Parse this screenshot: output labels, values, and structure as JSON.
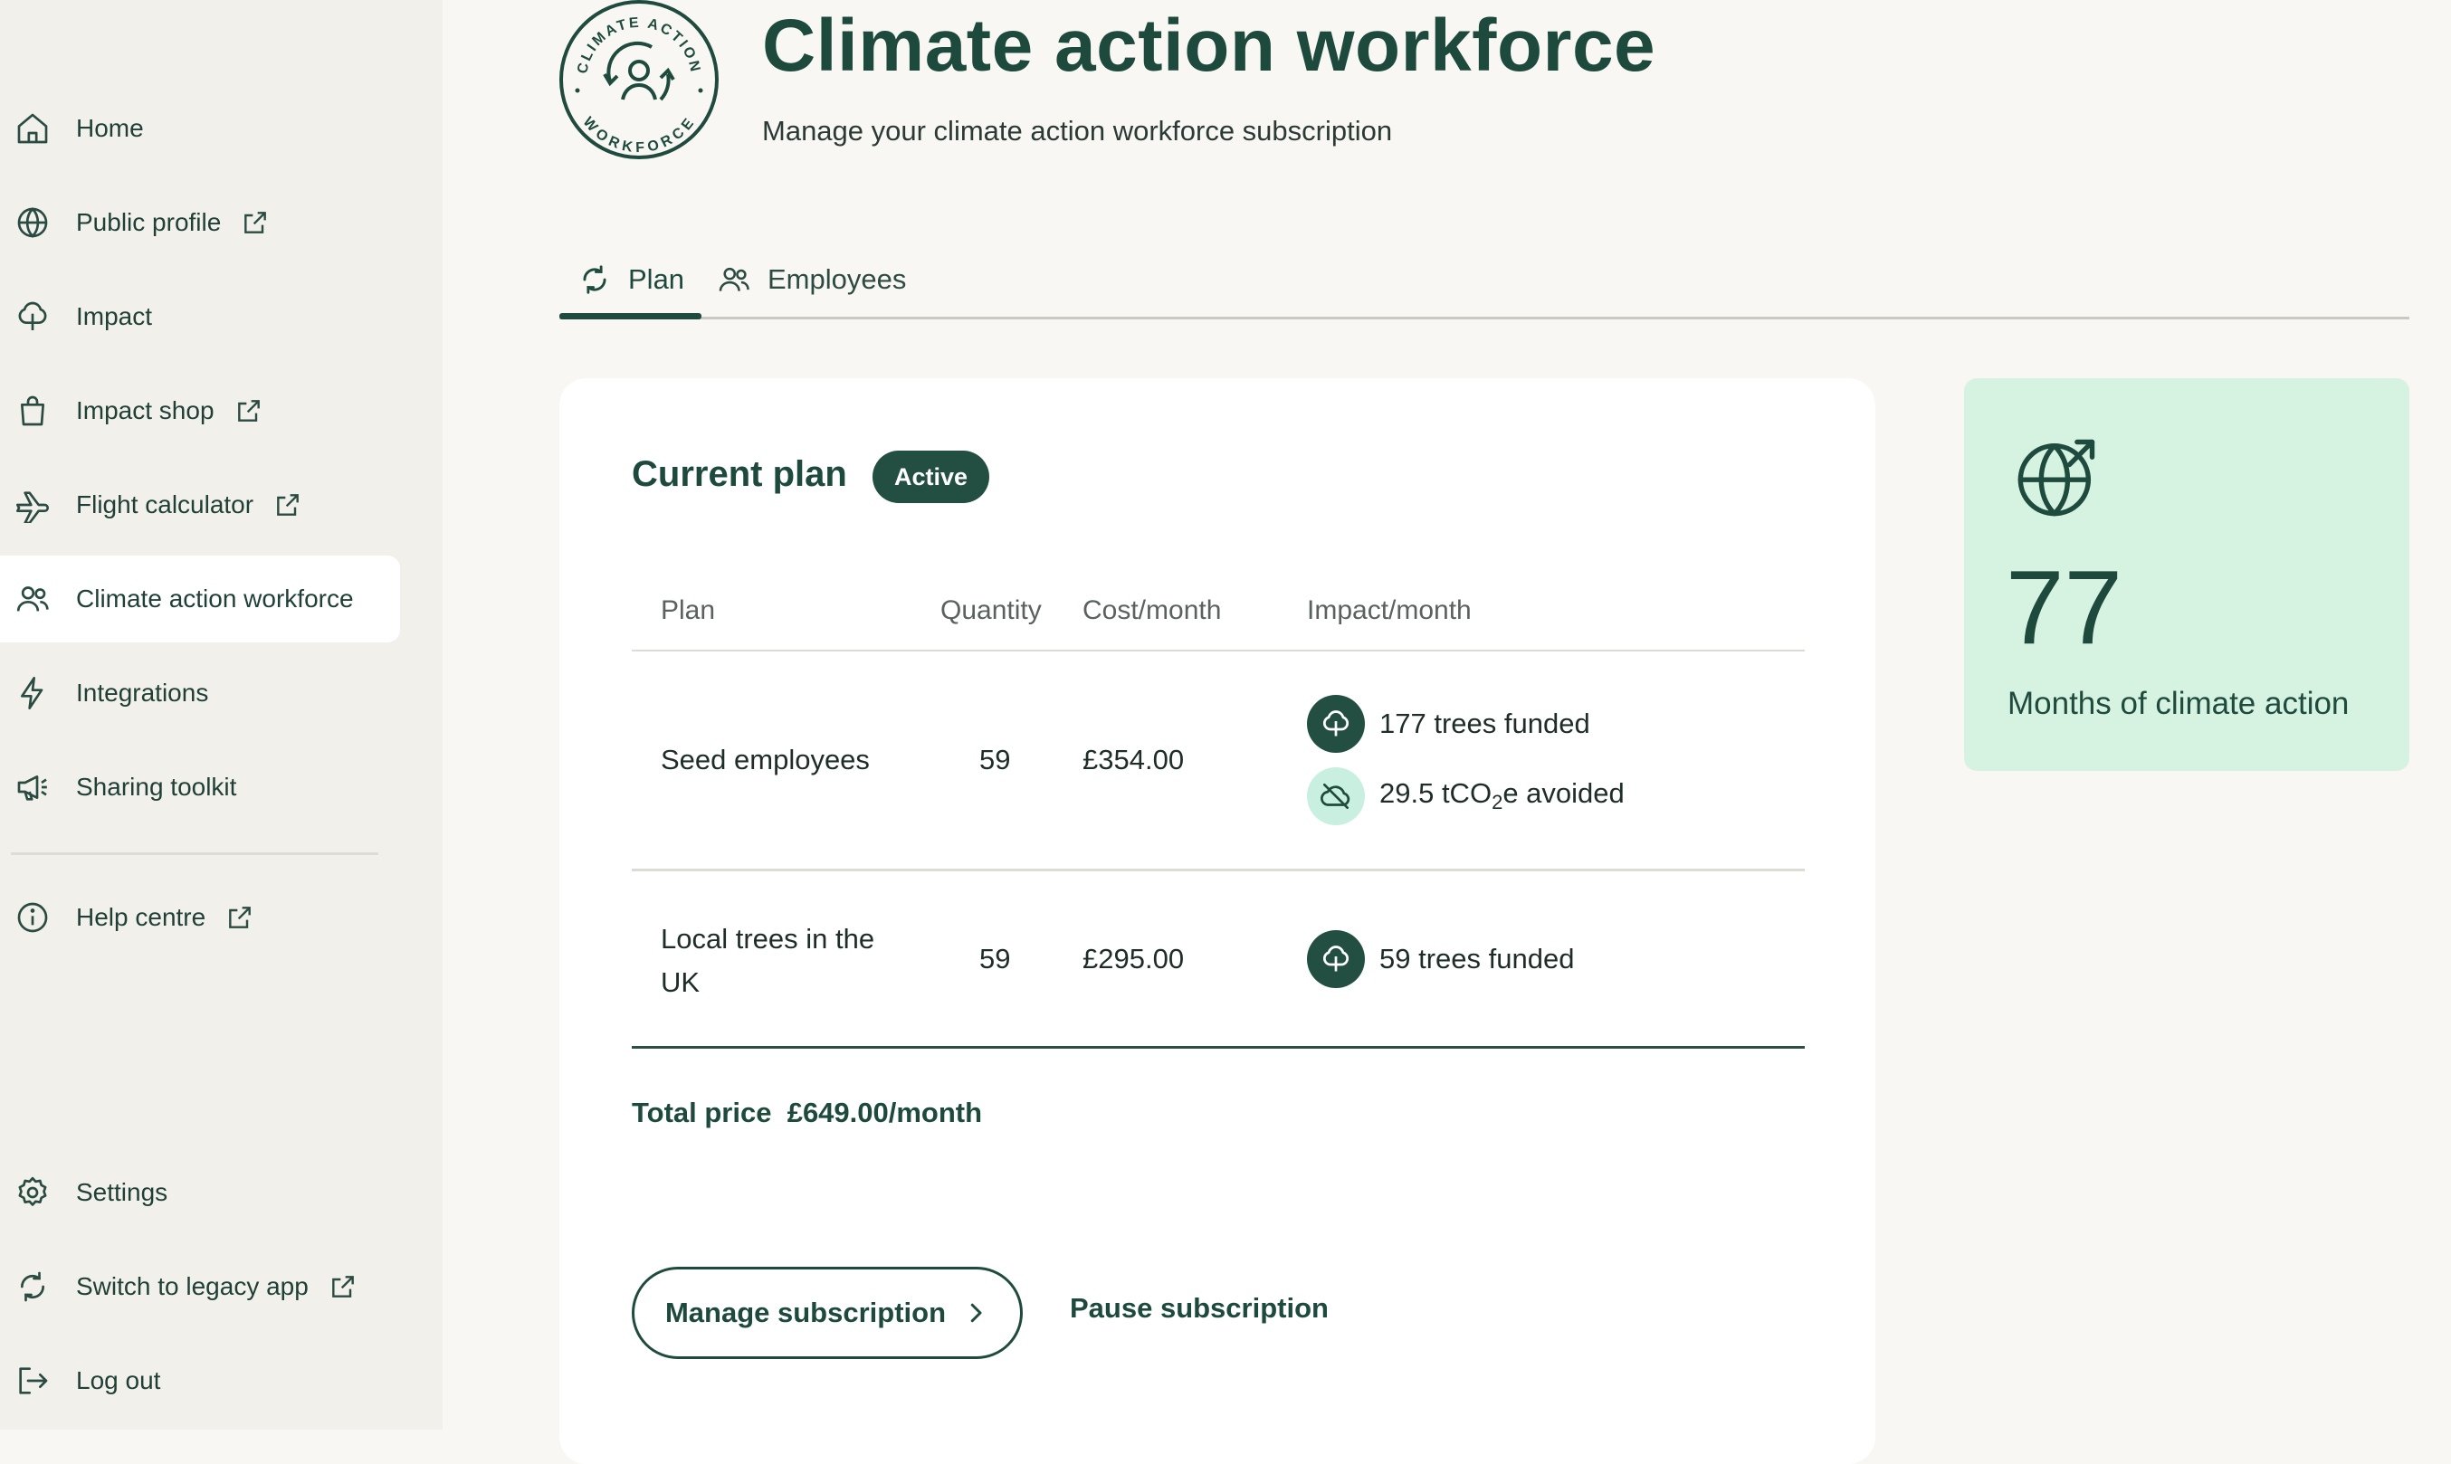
{
  "sidebar": {
    "items": [
      {
        "label": "Home",
        "icon": "home-icon"
      },
      {
        "label": "Public profile",
        "icon": "globe-icon",
        "external": true
      },
      {
        "label": "Impact",
        "icon": "tree-icon"
      },
      {
        "label": "Impact shop",
        "icon": "shopping-bag-icon",
        "external": true
      },
      {
        "label": "Flight calculator",
        "icon": "plane-icon",
        "external": true
      },
      {
        "label": "Climate action workforce",
        "icon": "users-icon",
        "active": true
      },
      {
        "label": "Integrations",
        "icon": "lightning-icon"
      },
      {
        "label": "Sharing toolkit",
        "icon": "megaphone-icon"
      },
      {
        "label": "Help centre",
        "icon": "info-icon",
        "external": true
      },
      {
        "label": "Settings",
        "icon": "gear-icon"
      },
      {
        "label": "Switch to legacy app",
        "icon": "refresh-icon",
        "external": true
      },
      {
        "label": "Log out",
        "icon": "logout-icon"
      }
    ]
  },
  "header": {
    "logo_text_top": "CLIMATE ACTION",
    "logo_text_bottom": "WORKFORCE",
    "title": "Climate action workforce",
    "subtitle": "Manage your climate action workforce subscription"
  },
  "tabs": [
    {
      "label": "Plan",
      "icon": "refresh-icon",
      "active": true
    },
    {
      "label": "Employees",
      "icon": "users-icon"
    }
  ],
  "plan_card": {
    "title": "Current plan",
    "status": "Active",
    "columns": [
      "Plan",
      "Quantity",
      "Cost/month",
      "Impact/month"
    ],
    "rows": [
      {
        "plan": "Seed employees",
        "quantity": "59",
        "cost": "£354.00",
        "impact": [
          {
            "icon": "tree-icon",
            "text": "177 trees funded"
          },
          {
            "icon": "cloud-off-icon",
            "text_pre": "29.5 tCO",
            "text_sub": "2",
            "text_post": "e avoided"
          }
        ]
      },
      {
        "plan_line1": "Local trees in the",
        "plan_line2": "UK",
        "quantity": "59",
        "cost": "£295.00",
        "impact": [
          {
            "icon": "tree-icon",
            "text": "59 trees funded"
          }
        ]
      }
    ],
    "total_label": "Total price",
    "total_value": "£649.00/month",
    "manage_label": "Manage subscription",
    "pause_label": "Pause subscription"
  },
  "stat_card": {
    "icon": "globe-arrow-icon",
    "value": "77",
    "label": "Months of climate action"
  },
  "colors": {
    "primary": "#1f4a3e",
    "sidebar_bg": "#f1f0ea",
    "page_bg": "#f8f7f3",
    "stat_bg": "#d6f3e2",
    "badge_bg": "#234e42"
  }
}
